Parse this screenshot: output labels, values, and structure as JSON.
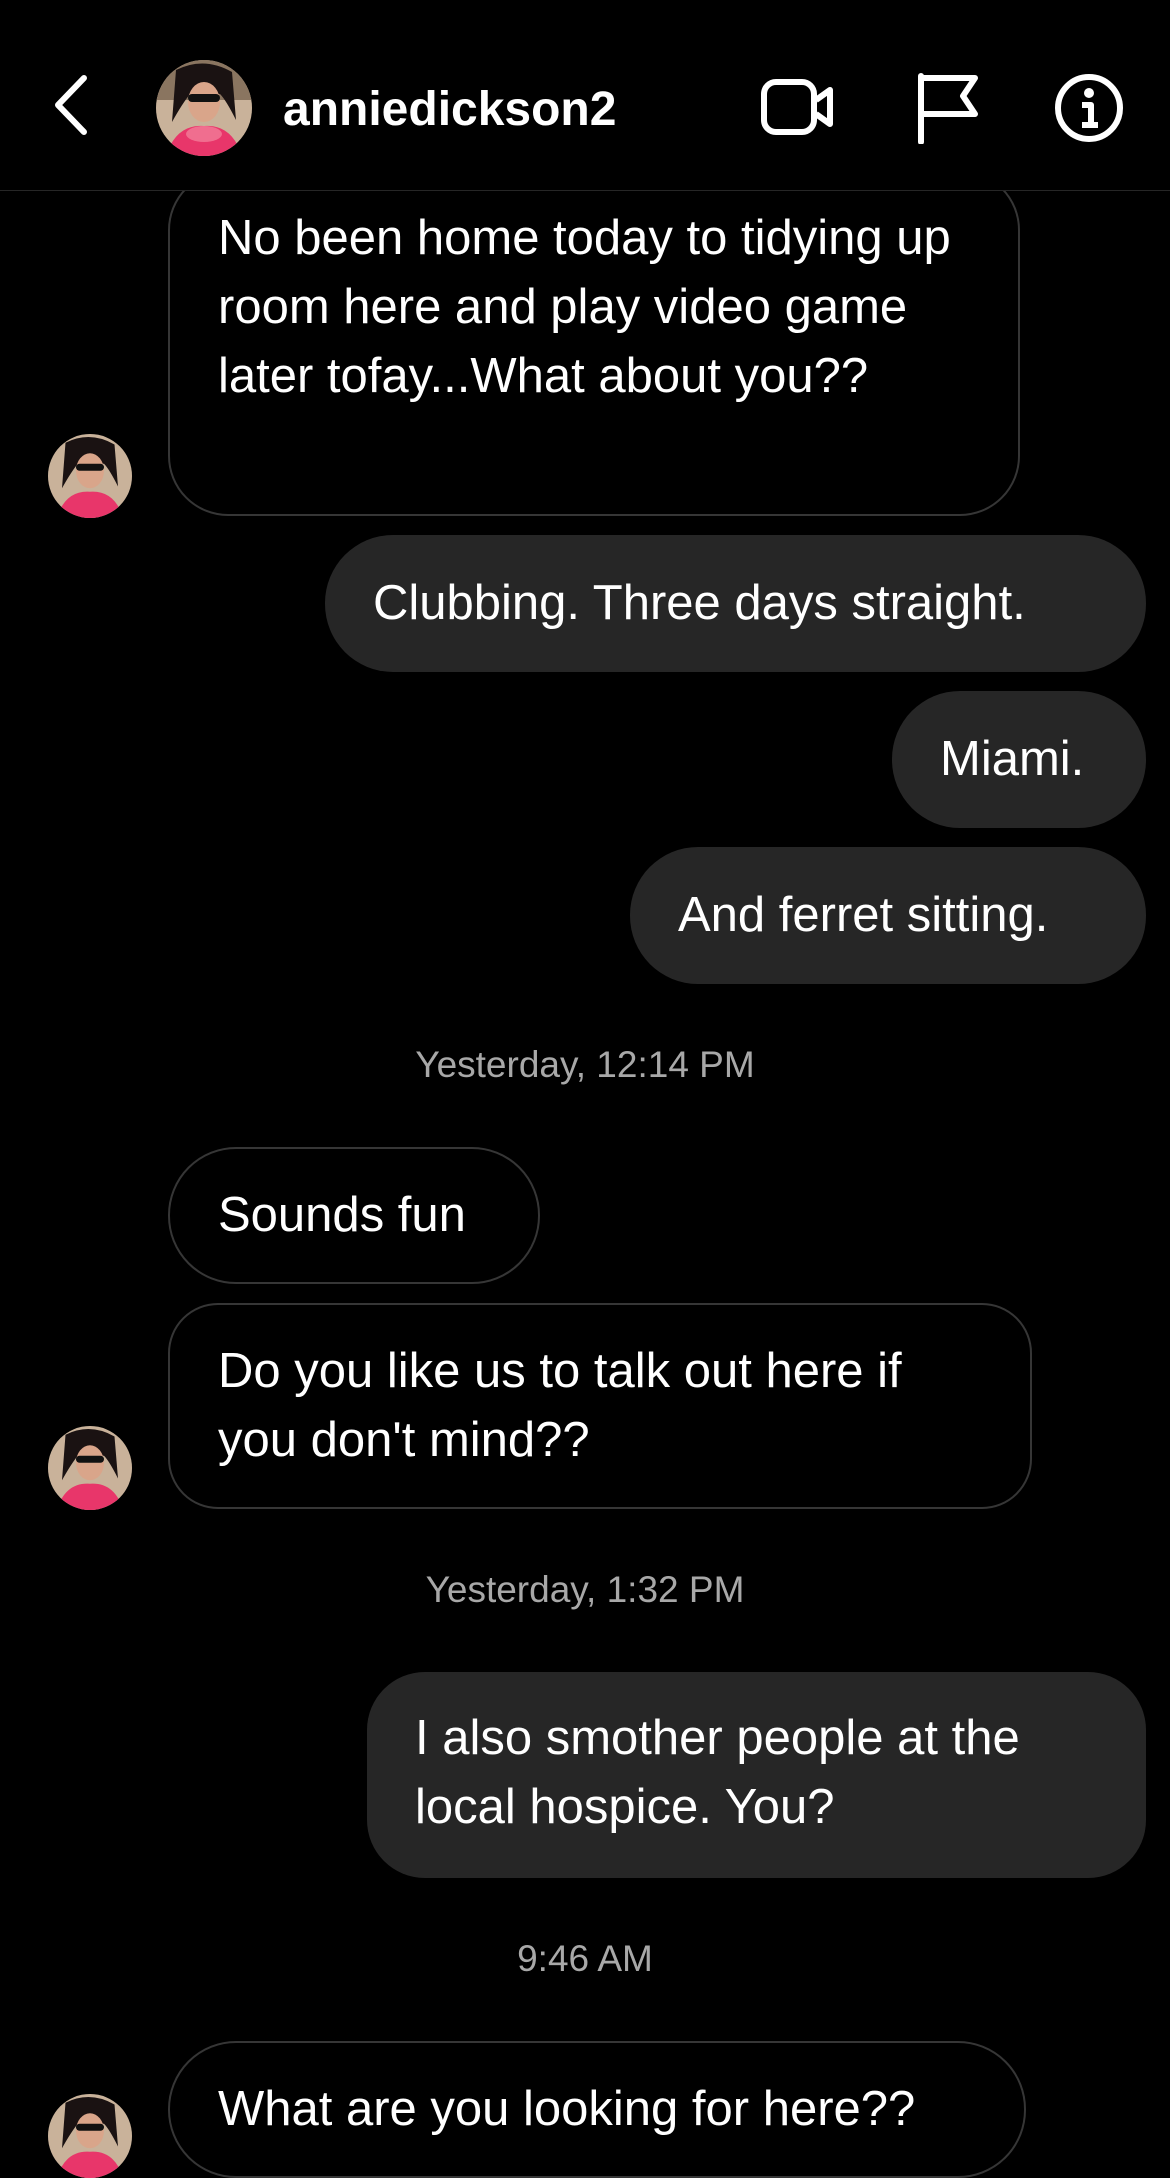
{
  "header": {
    "username": "anniedickson2",
    "icons": [
      "back-icon",
      "video-call-icon",
      "flag-icon",
      "info-icon"
    ]
  },
  "colors": {
    "background": "#000000",
    "outgoing_bubble": "#262626",
    "incoming_border": "#363636",
    "timestamp_text": "#a8a8a8",
    "text": "#ffffff"
  },
  "messages": [
    {
      "side": "incoming",
      "text": "No been home today to tidying up room here and play video game later tofay...What about you??"
    },
    {
      "side": "outgoing",
      "text": "Clubbing. Three days straight."
    },
    {
      "side": "outgoing",
      "text": "Miami."
    },
    {
      "side": "outgoing",
      "text": "And ferret sitting."
    },
    {
      "side": "incoming",
      "text": "Sounds fun"
    },
    {
      "side": "incoming",
      "text": "Do you like us to talk out here if you don't mind??"
    },
    {
      "side": "outgoing",
      "text": "I also smother people at the local hospice. You?"
    },
    {
      "side": "incoming",
      "text": "What are you looking for here??"
    }
  ],
  "timestamps": [
    "Yesterday, 12:14 PM",
    "Yesterday, 1:32 PM",
    "9:46 AM"
  ]
}
